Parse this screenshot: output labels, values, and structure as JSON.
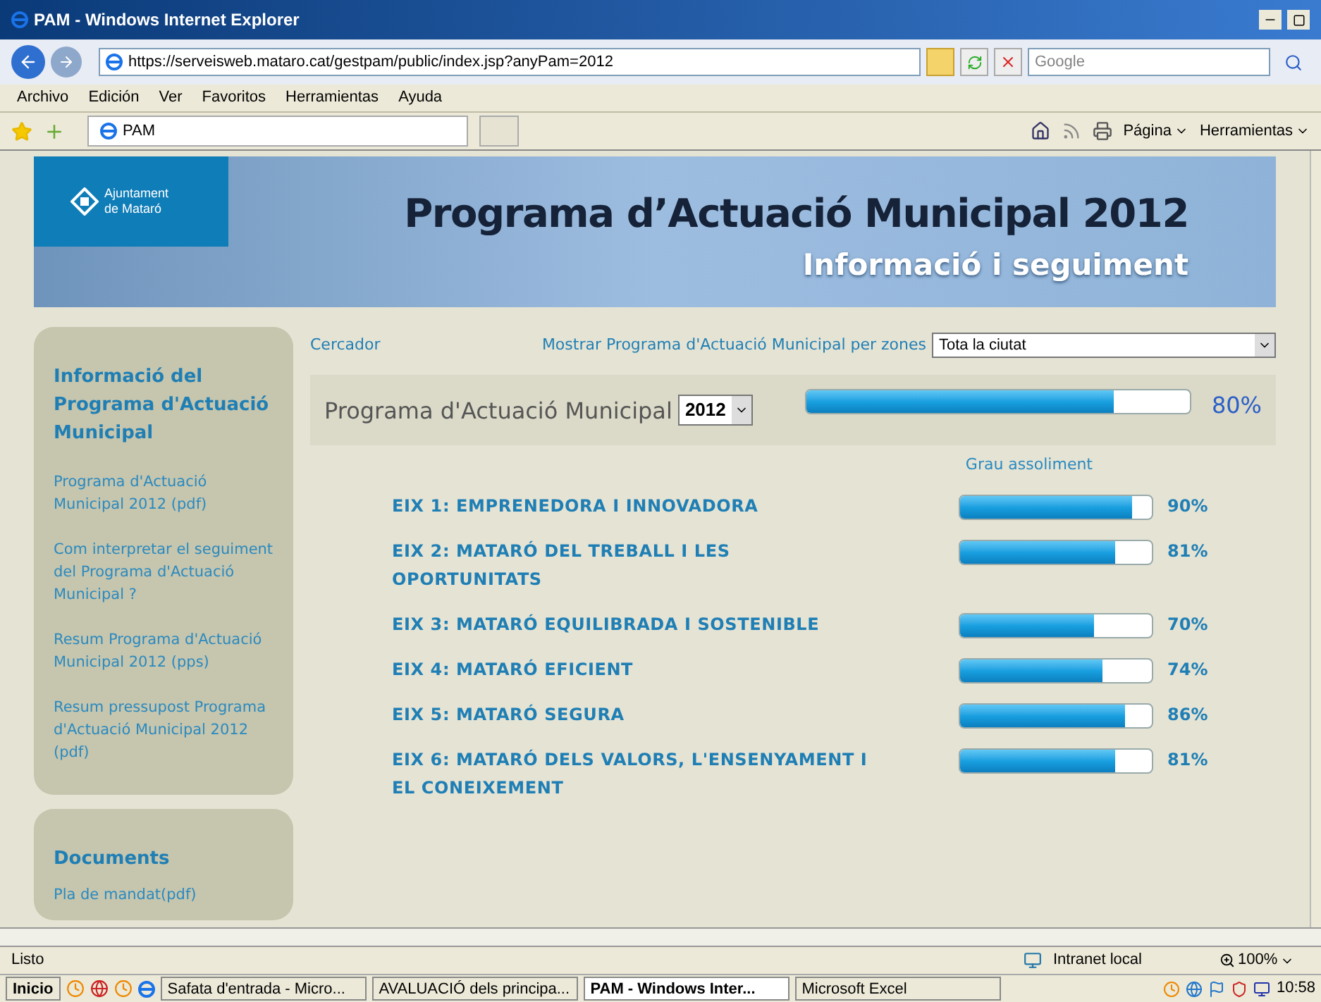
{
  "window": {
    "title": "PAM - Windows Internet Explorer"
  },
  "address_bar": {
    "url": "https://serveisweb.mataro.cat/gestpam/public/index.jsp?anyPam=2012",
    "search_placeholder": "Google"
  },
  "menu": [
    "Archivo",
    "Edición",
    "Ver",
    "Favoritos",
    "Herramientas",
    "Ayuda"
  ],
  "tab": {
    "label": "PAM",
    "selected": true
  },
  "command_bar": [
    "Página",
    "Herramientas"
  ],
  "banner": {
    "logo_line1": "Ajuntament",
    "logo_line2": "de Mataró",
    "title": "Programa d’Actuació Municipal",
    "year": "2012",
    "subtitle": "Informació i seguiment"
  },
  "sidebar": {
    "heading": "Informació del Programa d'Actuació Municipal",
    "links": [
      "Programa d'Actuació Municipal 2012 (pdf)",
      "Com interpretar el seguiment del Programa d'Actuació Municipal ?",
      "Resum Programa d'Actuació Municipal 2012 (pps)",
      "Resum pressupost Programa d'Actuació Municipal 2012 (pdf)"
    ],
    "heading2": "Documents",
    "links2": [
      "Pla de mandat(pdf)"
    ]
  },
  "toolbar": {
    "search_link": "Cercador",
    "zones_label": "Mostrar Programa d'Actuació Municipal per zones",
    "zones_value": "Tota la ciutat"
  },
  "summary": {
    "label": "Programa d'Actuació Municipal",
    "year": "2012",
    "level": 0.8,
    "reading": "80%"
  },
  "column_heading": "Grau assoliment",
  "axes": [
    {
      "name": "EIX 1: EMPRENEDORA I INNOVADORA",
      "level": 0.9,
      "reading": "90%"
    },
    {
      "name": "EIX 2: MATARÓ DEL TREBALL I LES OPORTUNITATS",
      "level": 0.81,
      "reading": "81%"
    },
    {
      "name": "EIX 3: MATARÓ EQUILIBRADA I SOSTENIBLE",
      "level": 0.7,
      "reading": "70%"
    },
    {
      "name": "EIX 4: MATARÓ EFICIENT",
      "level": 0.74,
      "reading": "74%"
    },
    {
      "name": "EIX 5: MATARÓ SEGURA",
      "level": 0.86,
      "reading": "86%"
    },
    {
      "name": "EIX 6: MATARÓ DELS VALORS, L'ENSENYAMENT I EL CONEIXEMENT",
      "level": 0.81,
      "reading": "81%"
    }
  ],
  "status_bar": {
    "text": "Listo",
    "zone": "Intranet local",
    "zoom": "100%"
  },
  "taskbar": {
    "start": "Inicio",
    "tasks": [
      {
        "label": "Safata d'entrada - Micro...",
        "selected": false
      },
      {
        "label": "AVALUACIÓ dels principa...",
        "selected": false
      },
      {
        "label": "PAM - Windows Inter...",
        "selected": true
      },
      {
        "label": "Microsoft Excel",
        "selected": false
      }
    ],
    "clock": "10:58"
  }
}
